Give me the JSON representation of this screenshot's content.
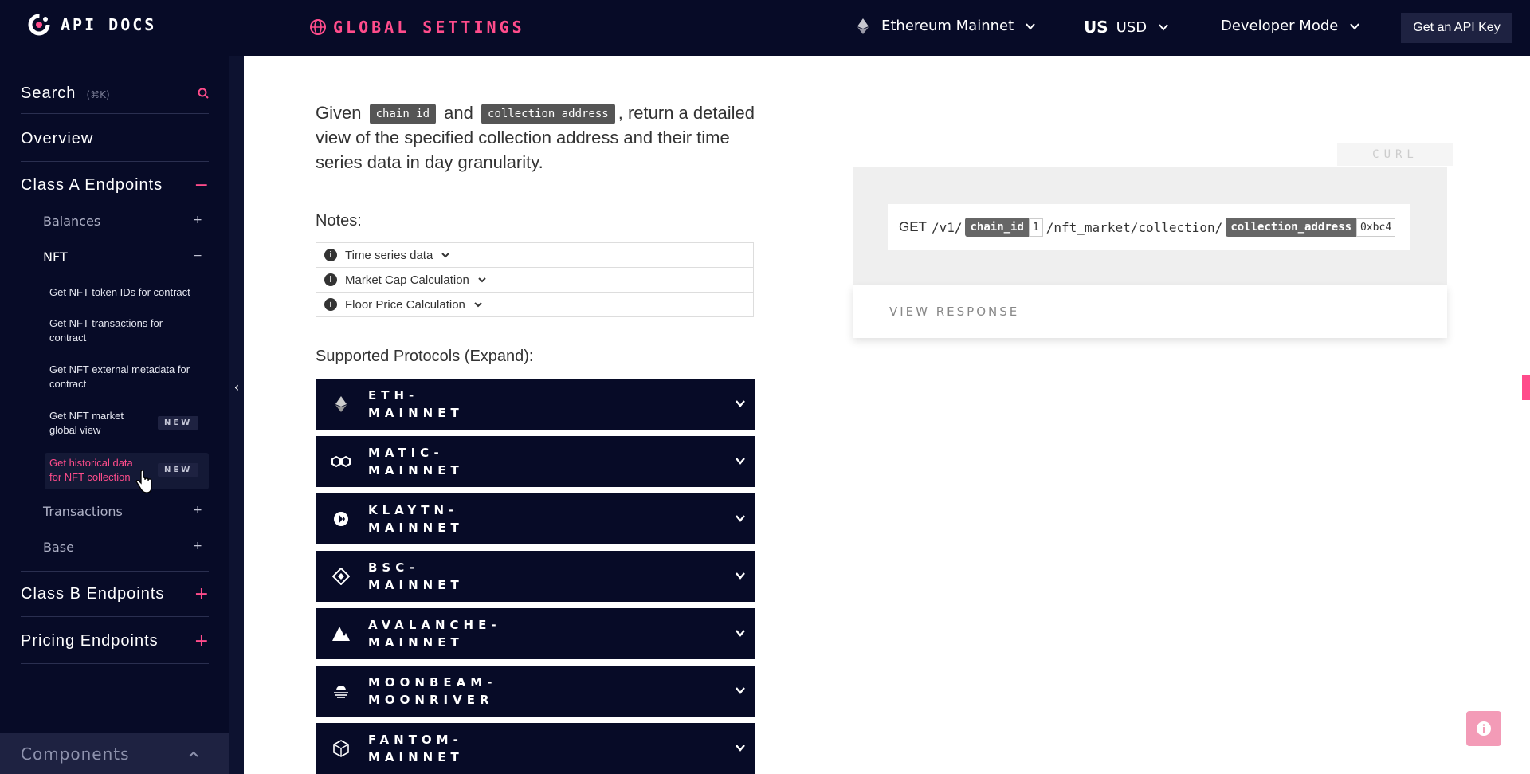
{
  "topbar": {
    "logo_text": "API DOCS",
    "global_settings": "GLOBAL SETTINGS",
    "network": "Ethereum Mainnet",
    "currency_flag": "US",
    "currency": "USD",
    "mode": "Developer Mode",
    "api_key_button": "Get an API Key"
  },
  "sidebar": {
    "search": "Search",
    "search_hint": "(⌘K)",
    "overview": "Overview",
    "class_a": "Class A Endpoints",
    "class_a_toggle": "−",
    "balances": "Balances",
    "balances_toggle": "+",
    "nft": "NFT",
    "nft_toggle": "−",
    "nft_items": [
      "Get NFT token IDs for contract",
      "Get NFT transactions for contract",
      "Get NFT external metadata for contract",
      "Get NFT market global view",
      "Get historical data for NFT collection"
    ],
    "new_badge": "NEW",
    "transactions": "Transactions",
    "transactions_toggle": "+",
    "base": "Base",
    "base_toggle": "+",
    "class_b": "Class B Endpoints",
    "class_b_toggle": "+",
    "pricing": "Pricing Endpoints",
    "pricing_toggle": "+",
    "components": "Components"
  },
  "main": {
    "desc_given": "Given",
    "desc_chip1": "chain_id",
    "desc_and": "and",
    "desc_chip2": "collection_address",
    "desc_rest": ", return a detailed view of the specified collection address and their time series data in day granularity.",
    "notes_label": "Notes:",
    "notes": [
      "Time series data",
      "Market Cap Calculation",
      "Floor Price Calculation"
    ],
    "protocols_label": "Supported Protocols (Expand):",
    "protocols": [
      {
        "line1": "ETH-",
        "line2": "MAINNET",
        "icon": "ethereum-icon"
      },
      {
        "line1": "MATIC-",
        "line2": "MAINNET",
        "icon": "polygon-icon"
      },
      {
        "line1": "KLAYTN-",
        "line2": "MAINNET",
        "icon": "klaytn-icon"
      },
      {
        "line1": "BSC-",
        "line2": "MAINNET",
        "icon": "bnb-icon"
      },
      {
        "line1": "AVALANCHE-",
        "line2": "MAINNET",
        "icon": "avalanche-icon"
      },
      {
        "line1": "MOONBEAM-",
        "line2": "MOONRIVER",
        "icon": "moonbeam-icon"
      },
      {
        "line1": "FANTOM-",
        "line2": "MAINNET",
        "icon": "fantom-icon"
      }
    ]
  },
  "request": {
    "curl_tab": "CURL",
    "method": "GET",
    "path1": "/v1/",
    "param1_name": "chain_id",
    "param1_value": "1",
    "path2": "/nft_market/collection/",
    "param2_name": "collection_address",
    "param2_value": "0xbc4",
    "view_response": "VIEW RESPONSE"
  },
  "colors": {
    "navy": "#070b27",
    "accent": "#ff4c8b"
  }
}
